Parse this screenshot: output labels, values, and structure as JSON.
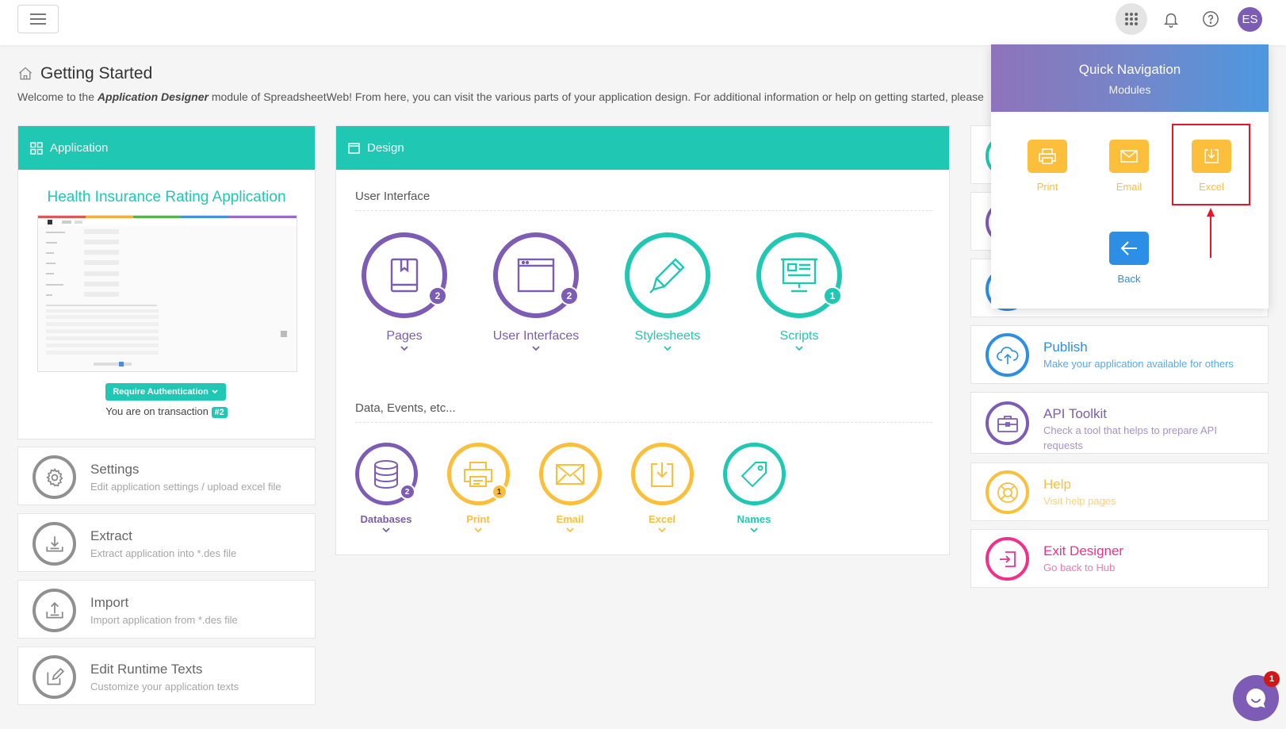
{
  "header": {
    "avatar_initials": "ES"
  },
  "page": {
    "title": "Getting Started",
    "welcome_prefix": "Welcome to the ",
    "welcome_emphasis": "Application Designer",
    "welcome_rest": " module of SpreadsheetWeb! From here, you can visit the various parts of your application design. For additional information or help on getting started, please"
  },
  "application": {
    "header": "Application",
    "app_name": "Health Insurance Rating Application",
    "auth_button": "Require Authentication",
    "transaction_text": "You are on transaction",
    "transaction_badge": "#2"
  },
  "left_cards": [
    {
      "title": "Settings",
      "subtitle": "Edit application settings / upload excel file",
      "icon": "gear-icon"
    },
    {
      "title": "Extract",
      "subtitle": "Extract application into *.des file",
      "icon": "download-tray-icon"
    },
    {
      "title": "Import",
      "subtitle": "Import application from *.des file",
      "icon": "upload-tray-icon"
    },
    {
      "title": "Edit Runtime Texts",
      "subtitle": "Customize your application texts",
      "icon": "edit-icon"
    }
  ],
  "design": {
    "header": "Design",
    "ui_section": "User Interface",
    "ui_items": [
      {
        "label": "Pages",
        "badge": "2",
        "color": "#7c5cb4",
        "icon": "book-icon"
      },
      {
        "label": "User Interfaces",
        "badge": "2",
        "color": "#7c5cb4",
        "icon": "window-icon"
      },
      {
        "label": "Stylesheets",
        "badge": "",
        "color": "#20c8b4",
        "icon": "pen-icon"
      },
      {
        "label": "Scripts",
        "badge": "1",
        "color": "#20c8b4",
        "icon": "presentation-icon"
      }
    ],
    "data_section": "Data, Events, etc...",
    "data_items": [
      {
        "label": "Databases",
        "badge": "2",
        "color": "#7c5cb4",
        "icon": "database-icon"
      },
      {
        "label": "Print",
        "badge": "1",
        "color": "#fbbf3c",
        "icon": "printer-icon"
      },
      {
        "label": "Email",
        "badge": "",
        "color": "#fbbf3c",
        "icon": "envelope-icon"
      },
      {
        "label": "Excel",
        "badge": "",
        "color": "#fbbf3c",
        "icon": "download-icon"
      },
      {
        "label": "Names",
        "badge": "",
        "color": "#20c8b4",
        "icon": "tag-icon"
      }
    ]
  },
  "right_cards": [
    {
      "title": "Publish",
      "subtitle": "Make your application available for others",
      "color": "#2d8ee6",
      "subcolor": "#5aa8ee",
      "icon": "cloud-upload-icon"
    },
    {
      "title": "API Toolkit",
      "subtitle": "Check a tool that helps to prepare API requests",
      "color": "#7c5cb4",
      "subcolor": "#a593c9",
      "icon": "briefcase-icon"
    },
    {
      "title": "Help",
      "subtitle": "Visit help pages",
      "color": "#fbbf3c",
      "subcolor": "#fbd27a",
      "icon": "lifebuoy-icon"
    },
    {
      "title": "Exit Designer",
      "subtitle": "Go back to Hub",
      "color": "#f0318c",
      "subcolor": "#f478b2",
      "icon": "exit-icon"
    }
  ],
  "quick_nav": {
    "title": "Quick Navigation",
    "subtitle": "Modules",
    "items": [
      {
        "label": "Print",
        "color": "#fbbf3c",
        "icon": "printer-icon"
      },
      {
        "label": "Email",
        "color": "#fbbf3c",
        "icon": "envelope-icon"
      },
      {
        "label": "Excel",
        "color": "#fbbf3c",
        "icon": "download-icon"
      },
      {
        "label": "Back",
        "color": "#2d8ee6",
        "icon": "arrow-left-icon"
      }
    ]
  },
  "chat": {
    "badge": "1"
  }
}
